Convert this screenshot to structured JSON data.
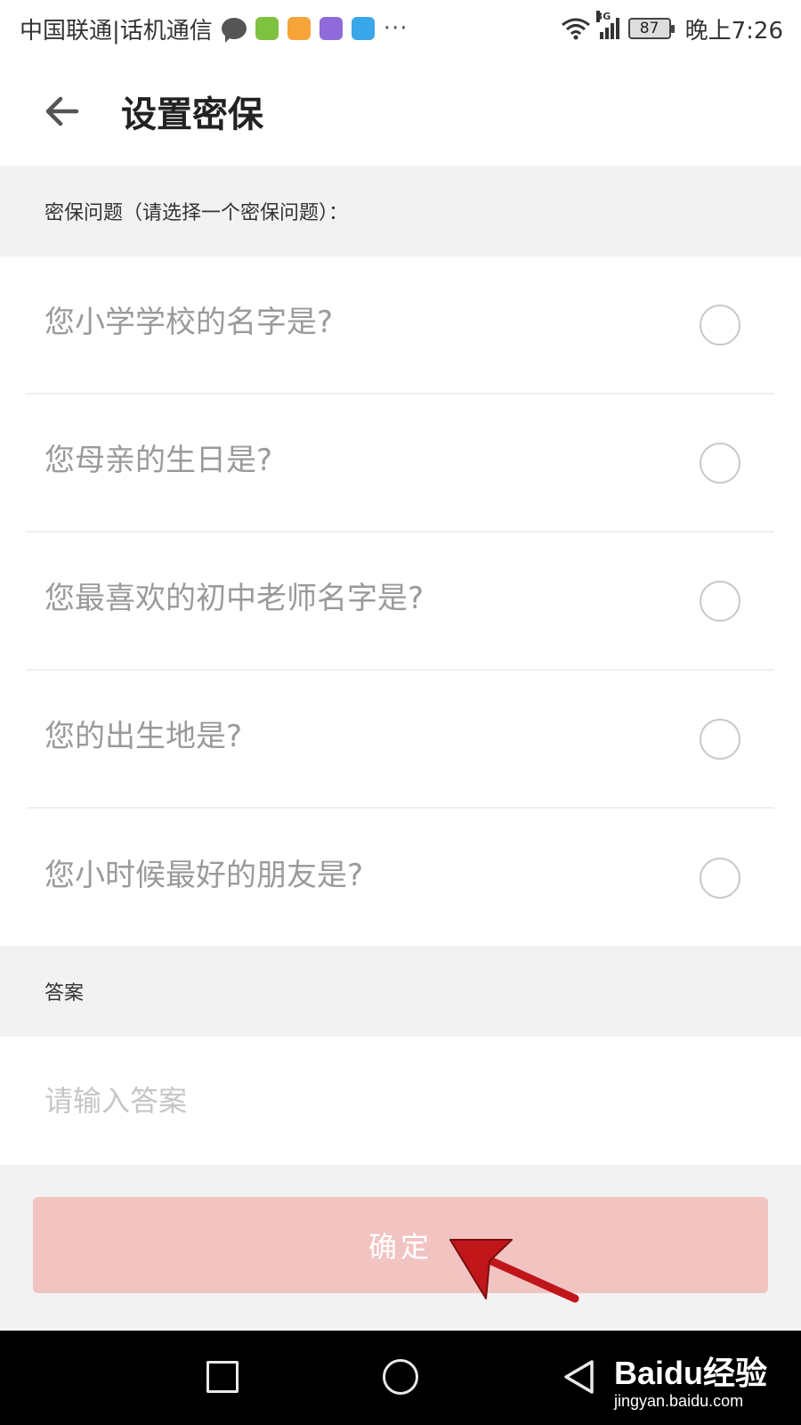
{
  "status_bar": {
    "carrier": "中国联通|话机通信",
    "signal_type": "3G",
    "battery": "87",
    "time": "晚上7:26",
    "more": "···",
    "notification_icons": [
      "chat-icon",
      "app-green-icon",
      "app-orange-icon",
      "app-purple-icon",
      "shield-blue-icon"
    ]
  },
  "header": {
    "title": "设置密保"
  },
  "question_section": {
    "label": "密保问题（请选择一个密保问题）："
  },
  "questions": [
    {
      "text": "您小学学校的名字是?",
      "selected": false
    },
    {
      "text": "您母亲的生日是?",
      "selected": false
    },
    {
      "text": "您最喜欢的初中老师名字是?",
      "selected": false
    },
    {
      "text": "您的出生地是?",
      "selected": false
    },
    {
      "text": "您小时候最好的朋友是?",
      "selected": false
    }
  ],
  "answer_section": {
    "label": "答案",
    "placeholder": "请输入答案",
    "value": ""
  },
  "confirm": {
    "label": "确定"
  },
  "watermark": {
    "brand": "Baidu经验",
    "url": "jingyan.baidu.com"
  },
  "colors": {
    "confirm_bg": "#f1c3c1",
    "annotation": "#c0161a",
    "section_bg": "#f2f2f2"
  }
}
